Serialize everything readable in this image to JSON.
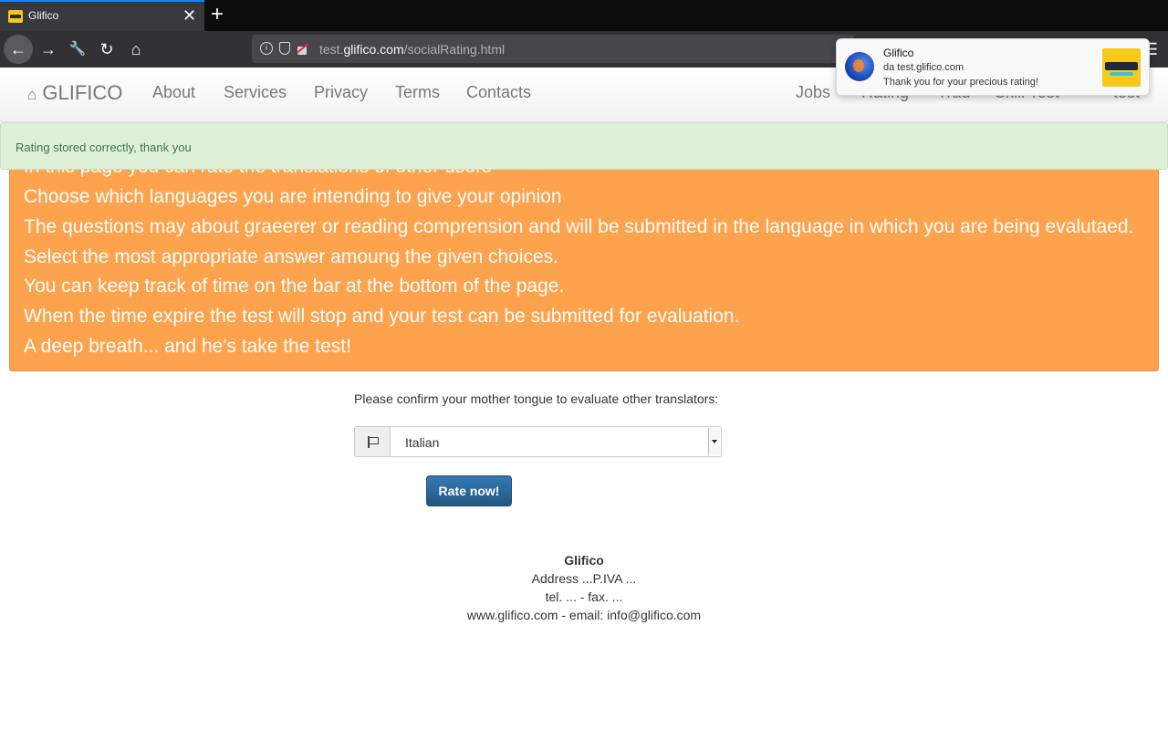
{
  "browser": {
    "tab_title": "Glifico",
    "tab_close": "✕",
    "new_tab": "+",
    "url_scheme_prefix": "test.",
    "url_host": "glifico.com",
    "url_path": "/socialRating.html",
    "icons": [
      "back-arrow-icon",
      "forward-arrow-icon",
      "wrench-icon",
      "reload-icon",
      "home-icon",
      "info-icon",
      "shield-icon",
      "insecure-lock-icon",
      "menu-icon"
    ]
  },
  "site_nav": {
    "brand": "GLIFICO",
    "links_left": [
      "About",
      "Services",
      "Privacy",
      "Terms",
      "Contacts"
    ],
    "links_right": [
      "Jobs",
      "Rating",
      "Trad",
      "Skill Test",
      "test"
    ]
  },
  "alert": {
    "text": "Rating stored correctly, thank you",
    "color": "#dff0d8"
  },
  "info": {
    "color": "#fda24d",
    "lines": [
      "In this page you can rate the translations of other users",
      "Choose which languages you are intending to give your opinion",
      "The questions may about graeerer or reading comprension and will be submitted in the language in which you are being evalutaed. Select the most appropriate answer amoung the given choices.",
      "You can keep track of time on the bar at the bottom of the page.",
      "When the time expire the test will stop and your test can be submitted for evaluation.",
      "A deep breath... and he's take the test!"
    ]
  },
  "form": {
    "prompt": "Please confirm your mother tongue to evaluate other translators:",
    "language_selected": "Italian",
    "submit_label": "Rate now!"
  },
  "footer": {
    "name": "Glifico",
    "address": "Address ...P.IVA ...",
    "phone": "tel. ... - fax. ...",
    "web": "www.glifico.com - email: info@glifico.com"
  },
  "notification": {
    "title": "Glifico",
    "origin": "da test.glifico.com",
    "body": "Thank you for your precious rating!"
  }
}
